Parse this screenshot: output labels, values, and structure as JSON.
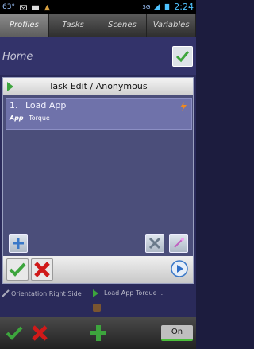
{
  "status_bar": {
    "temperature": "63°",
    "network": "3G",
    "time": "2:24"
  },
  "tabs": [
    {
      "label": "Profiles",
      "active": true
    },
    {
      "label": "Tasks",
      "active": false
    },
    {
      "label": "Scenes",
      "active": false
    },
    {
      "label": "Variables",
      "active": false
    }
  ],
  "background": {
    "home_label": "Home",
    "item1": "Orientation Right Side",
    "item2": "Load App Torque ...",
    "toggle_label": "On"
  },
  "dialog": {
    "title": "Task Edit / Anonymous",
    "action": {
      "number": "1.",
      "title": "Load App",
      "param_label": "App",
      "param_value": "Torque"
    }
  },
  "colors": {
    "accent_green": "#3da53d",
    "accent_red": "#d01919",
    "warn_orange": "#f08a1e"
  }
}
